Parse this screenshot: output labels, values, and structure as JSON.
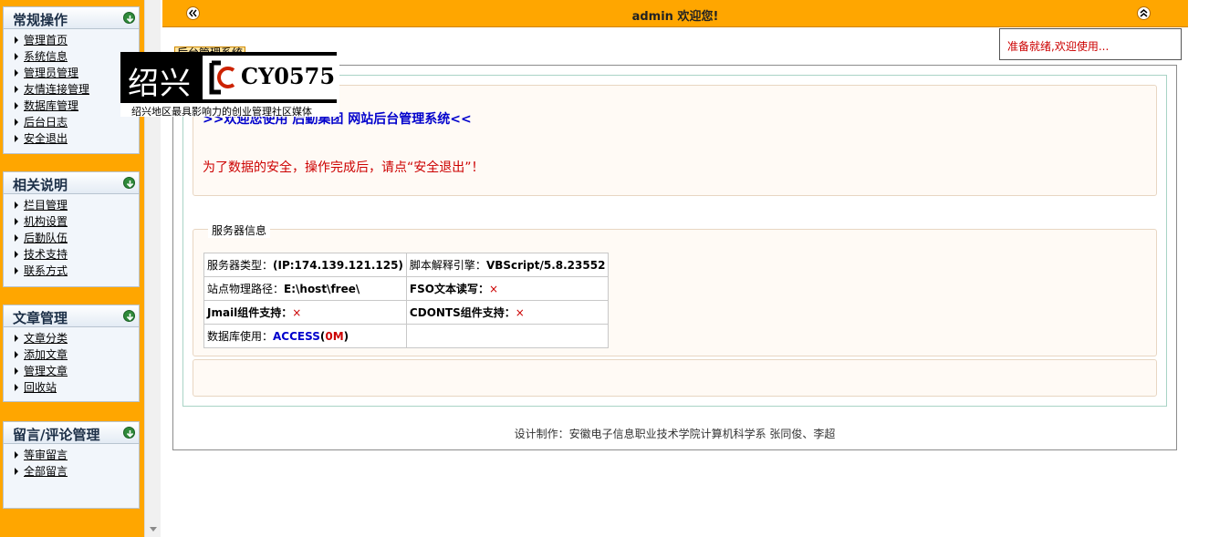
{
  "sidebar": {
    "panels": [
      {
        "title": "常规操作",
        "items": [
          "管理首页",
          "系统信息",
          "管理员管理",
          "友情连接管理",
          "数据库管理",
          "后台日志",
          "安全退出"
        ]
      },
      {
        "title": "相关说明",
        "items": [
          "栏目管理",
          "机构设置",
          "后勤队伍",
          "技术支持",
          "联系方式"
        ]
      },
      {
        "title": "文章管理",
        "items": [
          "文章分类",
          "添加文章",
          "管理文章",
          "回收站"
        ]
      },
      {
        "title": "留言/评论管理",
        "items": [
          "等审留言",
          "全部留言"
        ]
      }
    ]
  },
  "topbar": {
    "welcome": "admin 欢迎您!"
  },
  "status": {
    "text": "准备就绪,欢迎使用..."
  },
  "main": {
    "tab_label": "后台管理系统",
    "welcome_line": ">>欢迎您使用 后勤集团 网站后台管理系统<<",
    "warning_line": "为了数据的安全，操作完成后，请点“安全退出”！",
    "server_legend": "服务器信息",
    "server": {
      "type_label": "服务器类型：",
      "type_value": "(IP:174.139.121.125)",
      "engine_label": "脚本解释引擎：",
      "engine_value": "VBScript/5.8.23552",
      "path_label": "站点物理路径：",
      "path_value": "E:\\host\\free\\",
      "fso_label": "FSO文本读写：",
      "fso_value": "×",
      "jmail_label": "Jmail组件支持：",
      "jmail_value": "×",
      "cdonts_label": "CDONTS组件支持：",
      "cdonts_value": "×",
      "db_label": "数据库使用：",
      "db_name": "ACCESS",
      "db_open": "(",
      "db_size": "0M",
      "db_close": ")"
    },
    "credit": "设计制作：安徽电子信息职业技术学院计算机科学系 张同俊、李超"
  },
  "logo": {
    "city": "绍兴",
    "code": "CY0575",
    "tagline": "绍兴地区最具影响力的创业管理社区媒体"
  },
  "colors": {
    "accent_orange": "#ffa600",
    "warning_red": "#cc0000",
    "link_blue": "#0000cc"
  }
}
